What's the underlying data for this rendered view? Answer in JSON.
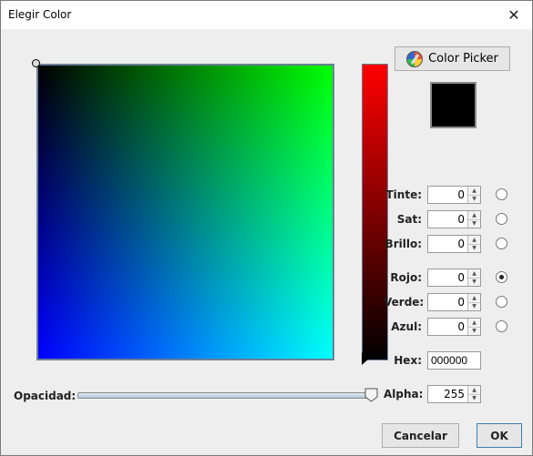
{
  "window": {
    "title": "Elegir Color",
    "close_glyph": "✕"
  },
  "picker_button": {
    "label": "Color Picker",
    "icon": "palette-icon"
  },
  "preview": {
    "color": "#000000"
  },
  "hsb": [
    {
      "label": "Tinte:",
      "value": "0",
      "selected": false
    },
    {
      "label": "Sat:",
      "value": "0",
      "selected": false
    },
    {
      "label": "Brillo:",
      "value": "0",
      "selected": false
    }
  ],
  "rgb": [
    {
      "label": "Rojo:",
      "value": "0",
      "selected": true
    },
    {
      "label": "Verde:",
      "value": "0",
      "selected": false
    },
    {
      "label": "Azul:",
      "value": "0",
      "selected": false
    }
  ],
  "hex": {
    "label": "Hex:",
    "value": "000000"
  },
  "opacity": {
    "label": "Opacidad:",
    "value": 1.0
  },
  "alpha": {
    "label": "Alpha:",
    "value": "255"
  },
  "buttons": {
    "cancel": "Cancelar",
    "ok": "OK"
  },
  "colors": {
    "sv_top_right": "#00ff00",
    "sv_bottom_left": "#0000ff",
    "sv_bottom_right": "#00ffff",
    "hue_top": "#ff0000",
    "hue_bottom": "#000000"
  }
}
